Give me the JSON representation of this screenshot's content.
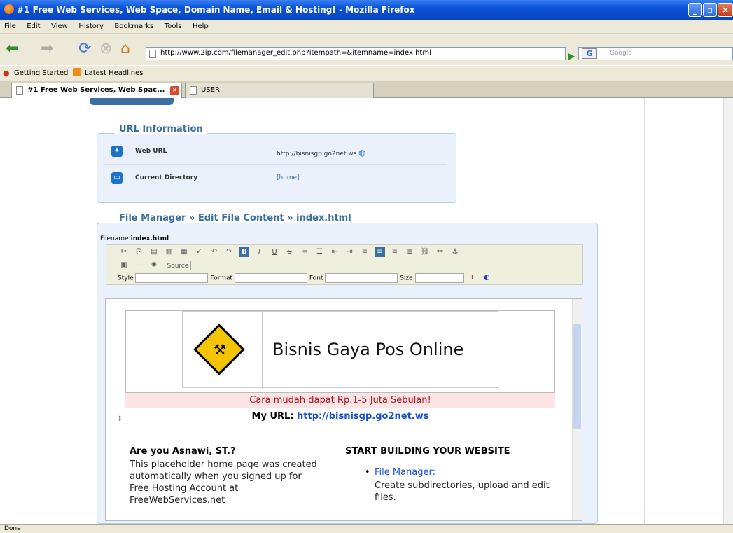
{
  "window": {
    "title": "#1 Free Web Services, Web Space, Domain Name, Email & Hosting! - Mozilla Firefox",
    "min": "_",
    "max": "▫",
    "close": "×"
  },
  "menu": [
    "File",
    "Edit",
    "View",
    "History",
    "Bookmarks",
    "Tools",
    "Help"
  ],
  "nav": {
    "url": "http://www.2ip.com/filemanager_edit.php?itempath=&itemname=index.html",
    "search_placeholder": "Google",
    "search_engine": "G"
  },
  "bookmarks": [
    "Getting Started",
    "Latest Headlines"
  ],
  "tabs": [
    {
      "label": "#1 Free Web Services, Web Spac..."
    },
    {
      "label": "USER"
    }
  ],
  "url_info": {
    "legend": "URL Information",
    "rows": [
      {
        "label": "Web URL",
        "value": "http://bisnisgp.go2net.ws"
      },
      {
        "label": "Current Directory",
        "value": "[home]"
      }
    ]
  },
  "file_manager": {
    "legend": "File Manager » Edit File Content » index.html",
    "filename_label": "Filename:",
    "filename": "index.html",
    "toolbar": {
      "source_label": "Source",
      "style_label": "Style",
      "format_label": "Format",
      "font_label": "Font",
      "size_label": "Size"
    }
  },
  "editor": {
    "banner_title": "Bisnis Gaya Pos Online",
    "tagline": "Cara mudah dapat Rp.1-5 Juta Sebulan!",
    "my_url_label": "My URL:",
    "my_url": "http://bisnisgp.go2net.ws",
    "greeting": "Are you Asnawi, ST.?",
    "placeholder_text": "This placeholder home page was created automatically when you signed up for Free Hosting Account at FreeWebServices.net",
    "start_heading": "START BUILDING YOUR WEBSITE",
    "file_manager_link": "File Manager:",
    "file_manager_desc": "Create subdirectories, upload and edit files."
  },
  "status": "Done",
  "colors": {
    "accent": "#3a6ea5",
    "tagline": "#b0141c",
    "tagline_bg": "#fde4e4",
    "link": "#1a4fd1"
  }
}
